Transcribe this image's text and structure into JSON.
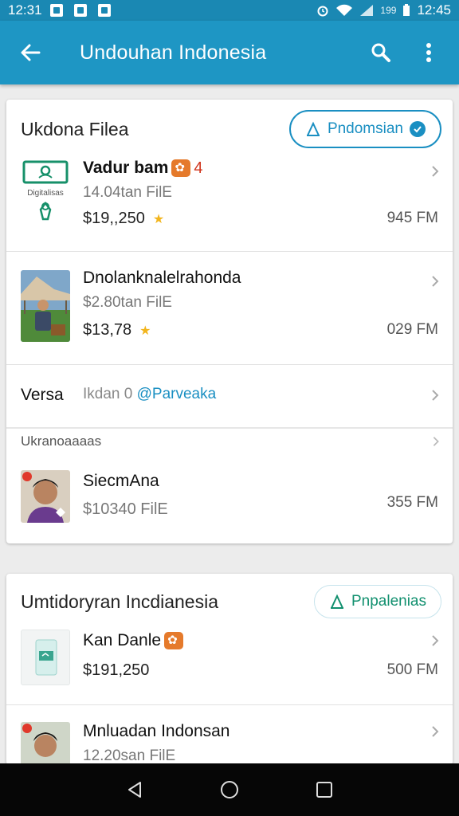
{
  "status_bar": {
    "time_left": "12:31",
    "battery_text": "199",
    "time_right": "12:45"
  },
  "app_bar": {
    "title": "Undouhan Indonesia"
  },
  "section1": {
    "title": "Ukdona Filea",
    "pill_label": "Pndomsian",
    "items": [
      {
        "name": "Vadur bam",
        "badge_num": "4",
        "subtitle": "14.04tan FilE",
        "price": "$19,,250",
        "size": "945 FM",
        "thumb_caption": "Digitalisas"
      },
      {
        "name": "Dnolanknalelrahonda",
        "subtitle": "$2.80tan FilE",
        "price": "$13,78",
        "size": "029 FM"
      }
    ],
    "versa_row": {
      "label": "Versa",
      "text": "Ikdan 0",
      "link": "@Parveaka"
    },
    "subsection_label": "Ukranoaaaas",
    "sub_item": {
      "name": "SiecmAna",
      "price_sub": "$10340 FilE",
      "size": "355 FM"
    }
  },
  "section2": {
    "title": "Umtidoryran Incdianesia",
    "pill_label": "Pnpalenias",
    "items": [
      {
        "name": "Kan Danle",
        "price": "$191,250",
        "size": "500 FM"
      },
      {
        "name": "Mnluadan Indonsan",
        "subtitle": "12.20san FilE"
      }
    ]
  },
  "colors": {
    "primary": "#1e96c4",
    "status_bar": "#1a88b3",
    "accent_orange": "#e57a2b",
    "star": "#f2b51d",
    "pill_green": "#12906f"
  }
}
